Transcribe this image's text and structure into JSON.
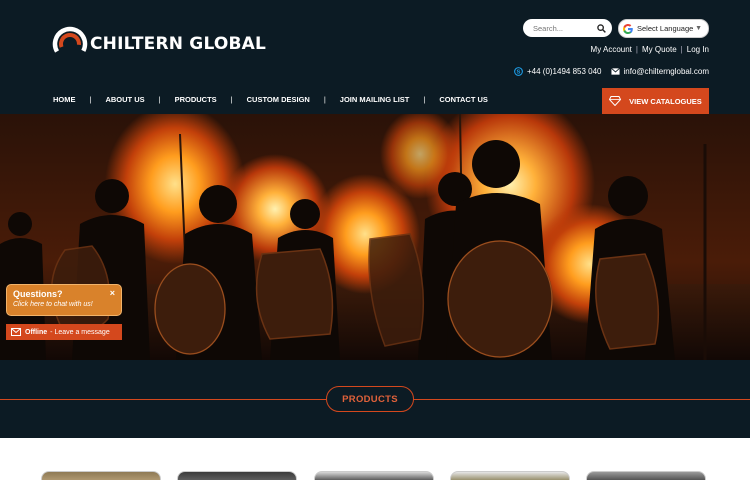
{
  "brand": {
    "name": "CHILTERN GLOBAL"
  },
  "search": {
    "placeholder": "Search..."
  },
  "language": {
    "label": "Select Language"
  },
  "account": {
    "my_account": "My Account",
    "my_quote": "My Quote",
    "login": "Log In"
  },
  "contact": {
    "phone": "+44 (0)1494 853 040",
    "email": "info@chilternglobal.com"
  },
  "nav": {
    "items": [
      "HOME",
      "ABOUT US",
      "PRODUCTS",
      "CUSTOM DESIGN",
      "JOIN MAILING LIST",
      "CONTACT US"
    ],
    "separator": "|"
  },
  "cta": {
    "catalogues": "VIEW CATALOGUES"
  },
  "chat": {
    "title": "Questions?",
    "subtitle": "Click here to chat with us!",
    "close": "×",
    "offline_status": "Offline",
    "offline_message": "- Leave a message"
  },
  "section": {
    "products_title": "PRODUCTS"
  },
  "colors": {
    "background": "#0c1b24",
    "accent": "#d4481d",
    "chat": "#d9822b",
    "white": "#ffffff"
  },
  "icons": [
    "search-icon",
    "google-icon",
    "skype-icon",
    "email-icon",
    "diamond-icon",
    "mail-icon",
    "close-icon"
  ]
}
